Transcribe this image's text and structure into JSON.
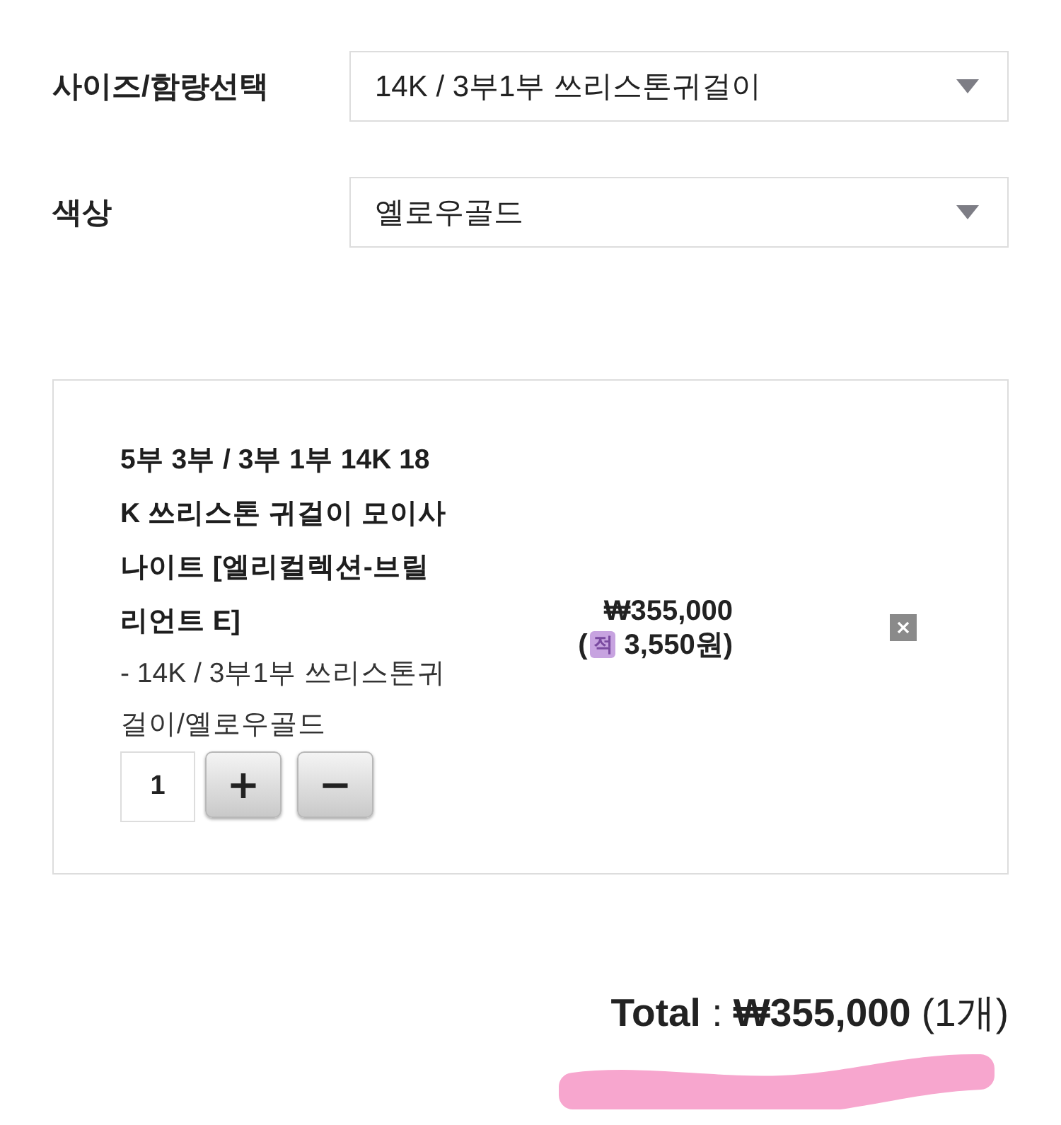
{
  "options": [
    {
      "label": "사이즈/함량선택",
      "value": "14K / 3부1부 쓰리스톤귀걸이"
    },
    {
      "label": "색상",
      "value": "옐로우골드"
    }
  ],
  "cart_item": {
    "name": "5부 3부 / 3부 1부 14K 18K 쓰리스톤 귀걸이 모이사나이트 [엘리컬렉션-브릴리언트 E]",
    "option": "- 14K / 3부1부 쓰리스톤귀걸이/옐로우골드",
    "quantity": "1",
    "increase": "+",
    "decrease": "−",
    "price": "₩355,000",
    "points_prefix": "(",
    "points_badge": "적",
    "points": "3,550원)"
  },
  "total": "**Total** : **₩355,000** (1개)"
}
